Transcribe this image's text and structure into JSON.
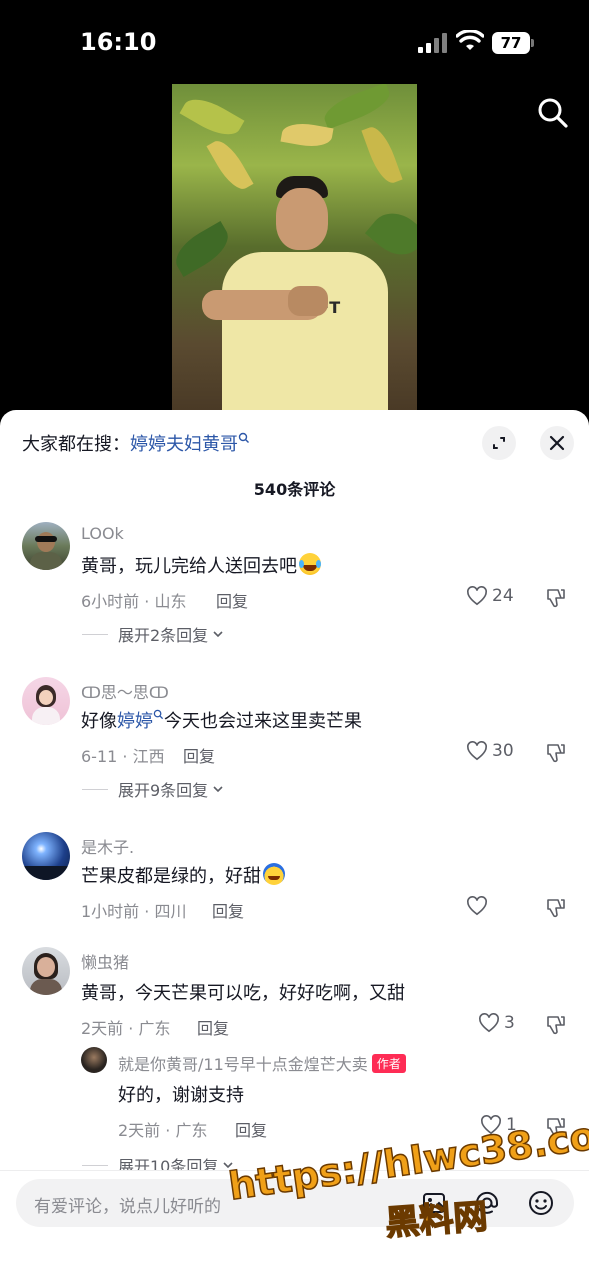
{
  "status_bar": {
    "time": "16:10",
    "battery": "77"
  },
  "video": {
    "shirt_print": "AL AFT"
  },
  "sheet": {
    "search_prefix": "大家都在搜：",
    "search_keyword": "婷婷夫妇黄哥",
    "comment_count": "540条评论"
  },
  "comments": [
    {
      "user": "LOOk",
      "text": "黄哥，玩儿完给人送回去吧",
      "meta": "6小时前 · 山东",
      "reply_label": "回复",
      "likes": "24",
      "expand": "展开2条回复"
    },
    {
      "user": "ↀ思～思ↀ",
      "text_before": "好像",
      "text_keyword": "婷婷",
      "text_after": "今天也会过来这里卖芒果",
      "meta": "6-11 · 江西",
      "reply_label": "回复",
      "likes": "30",
      "expand": "展开9条回复"
    },
    {
      "user": "是木子.",
      "text": "芒果皮都是绿的，好甜",
      "meta": "1小时前 · 四川",
      "reply_label": "回复",
      "likes": ""
    },
    {
      "user": "懒虫猪",
      "text": "黄哥，今天芒果可以吃，好好吃啊，又甜",
      "meta": "2天前 · 广东",
      "reply_label": "回复",
      "likes": "3",
      "sub_reply": {
        "user": "就是你黄哥/11号早十点金煌芒大卖",
        "tag": "作者",
        "text": "好的，谢谢支持",
        "meta": "2天前 · 广东",
        "reply_label": "回复",
        "likes": "1"
      },
      "expand": "展开10条回复"
    }
  ],
  "input": {
    "placeholder": "有爱评论，说点儿好听的"
  },
  "watermark": {
    "url": "https://hlwc38.com",
    "name": "黑料网"
  },
  "colors": {
    "keyword_blue": "#2c57a8",
    "author_red": "#fe2c55",
    "watermark_orange": "#f0a018"
  }
}
